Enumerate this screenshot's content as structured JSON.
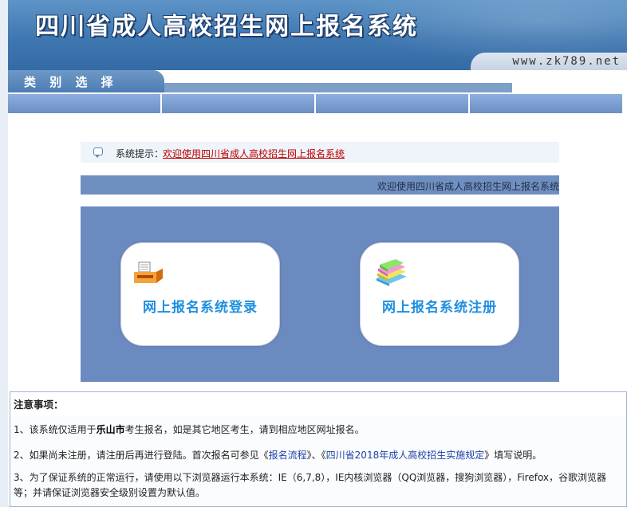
{
  "header": {
    "title": "四川省成人高校招生网上报名系统",
    "url": "www.zk789.net"
  },
  "category": {
    "label": "类 别 选 择"
  },
  "tip": {
    "label": "系统提示：",
    "message": "欢迎使用四川省成人高校招生网上报名系统"
  },
  "marquee": {
    "text": "欢迎使用四川省成人高校招生网上报名系统"
  },
  "cards": {
    "login": {
      "label": "网上报名系统登录",
      "icon": "printer-icon"
    },
    "register": {
      "label": "网上报名系统注册",
      "icon": "books-icon"
    }
  },
  "notes": {
    "title": "注意事项：",
    "item1": {
      "pre": "1、该系统仅适用于",
      "city": "乐山市",
      "post": "考生报名，如是其它地区考生，请到相应地区网址报名。"
    },
    "item2": {
      "pre": "2、如果尚未注册，请注册后再进行登陆。首次报名可参见《",
      "link1": "报名流程",
      "mid": "》、《",
      "link2": "四川省2018年成人高校招生实施规定",
      "post": "》填写说明。"
    },
    "item3": "3、为了保证系统的正常运行，请使用以下浏览器运行本系统：IE（6,7,8），IE内核浏览器（QQ浏览器，搜狗浏览器），Firefox，谷歌浏览器等；并请保证浏览器安全级别设置为默认值。"
  },
  "colors": {
    "header": "#3f77b1",
    "panel": "#6b8ac0",
    "card_text": "#1e8fe0",
    "tip_link": "#c00000"
  }
}
